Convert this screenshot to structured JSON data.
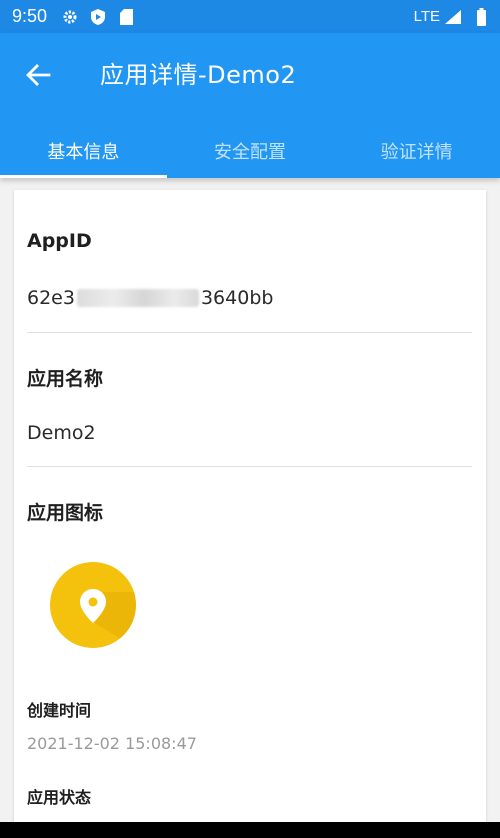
{
  "status_bar": {
    "time": "9:50",
    "network": "LTE"
  },
  "app_bar": {
    "title": "应用详情-Demo2"
  },
  "tabs": [
    {
      "label": "基本信息",
      "active": true
    },
    {
      "label": "安全配置",
      "active": false
    },
    {
      "label": "验证详情",
      "active": false
    }
  ],
  "details": {
    "appid_label": "AppID",
    "appid_prefix": "62e3",
    "appid_suffix": "3640bb",
    "app_name_label": "应用名称",
    "app_name_value": "Demo2",
    "app_icon_label": "应用图标",
    "app_icon": "location-pin-icon",
    "created_label": "创建时间",
    "created_value": "2021-12-02 15:08:47",
    "status_label": "应用状态"
  },
  "colors": {
    "primary": "#2196f3",
    "status_bar": "#1e88e5",
    "icon_bg": "#f4c20d"
  }
}
